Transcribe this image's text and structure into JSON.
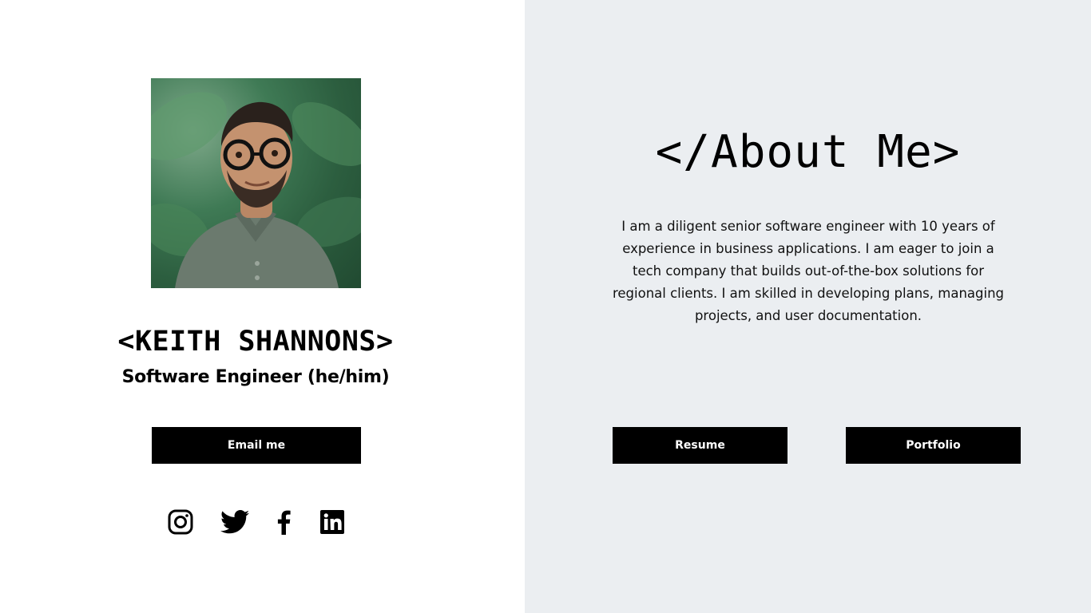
{
  "profile": {
    "name": "<KEITH SHANNONS>",
    "subtitle": "Software Engineer (he/him)",
    "photo_alt": "Portrait photo of Keith Shannons"
  },
  "buttons": {
    "email": "Email me",
    "resume": "Resume",
    "portfolio": "Portfolio"
  },
  "social": [
    {
      "name": "instagram",
      "icon": "instagram-icon"
    },
    {
      "name": "twitter",
      "icon": "twitter-icon"
    },
    {
      "name": "facebook",
      "icon": "facebook-icon"
    },
    {
      "name": "linkedin",
      "icon": "linkedin-icon"
    }
  ],
  "about": {
    "title": "</About Me>",
    "body": "I am a diligent senior software engineer with 10 years of experience in business applications. I am eager to join a tech company that builds out-of-the-box solutions for regional clients. I am skilled in developing plans, managing projects, and user documentation."
  },
  "colors": {
    "left_bg": "#ffffff",
    "right_bg": "#ebeef1",
    "button_bg": "#000000",
    "button_text": "#ffffff"
  }
}
